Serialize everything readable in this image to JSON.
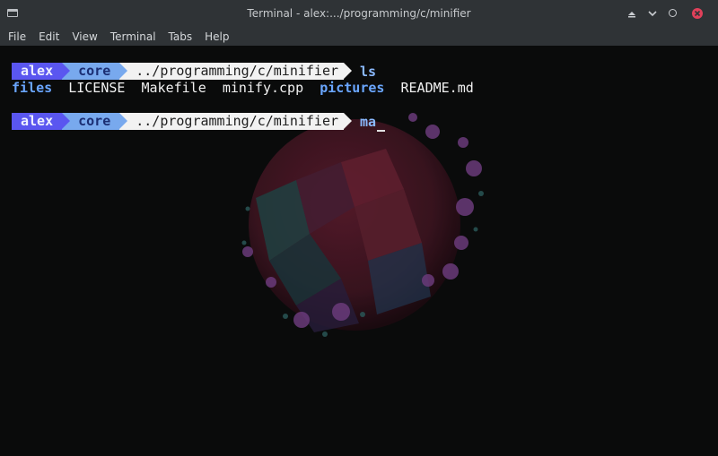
{
  "window": {
    "title": "Terminal - alex:.../programming/c/minifier"
  },
  "menu": [
    "File",
    "Edit",
    "View",
    "Terminal",
    "Tabs",
    "Help"
  ],
  "colors": {
    "prompt_user_bg": "#5a56f0",
    "prompt_host_bg": "#78a9ee",
    "prompt_path_bg": "#f2f2f2",
    "directory": "#6aa6ff",
    "terminal_bg": "#0a0b0b"
  },
  "prompt1": {
    "user": "alex",
    "host": "core",
    "path": "../programming/c/minifier",
    "command": "ls"
  },
  "listing": [
    {
      "name": "files",
      "type": "directory"
    },
    {
      "name": "LICENSE",
      "type": "file"
    },
    {
      "name": "Makefile",
      "type": "file"
    },
    {
      "name": "minify.cpp",
      "type": "file"
    },
    {
      "name": "pictures",
      "type": "directory"
    },
    {
      "name": "README.md",
      "type": "file"
    }
  ],
  "prompt2": {
    "user": "alex",
    "host": "core",
    "path": "../programming/c/minifier",
    "command": "ma"
  },
  "icons": {
    "app": "terminal-icon",
    "shade": "shade-icon",
    "minimize": "minimize-icon",
    "maximize": "maximize-icon",
    "close": "close-icon"
  }
}
